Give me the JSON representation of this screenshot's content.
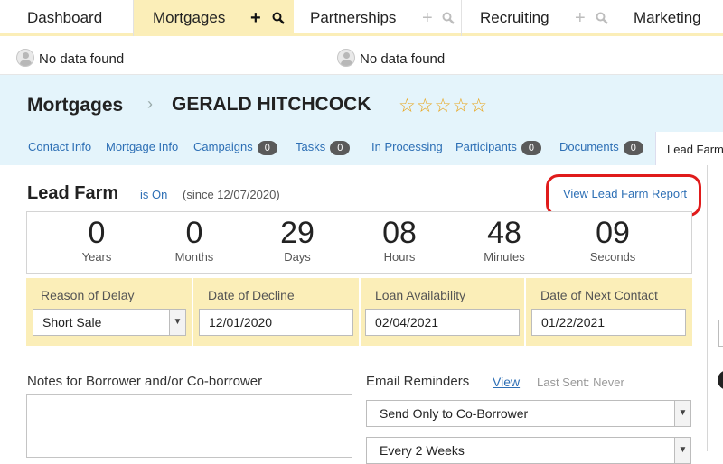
{
  "topnav": {
    "tabs": [
      {
        "label": "Dashboard"
      },
      {
        "label": "Mortgages"
      },
      {
        "label": "Partnerships"
      },
      {
        "label": "Recruiting"
      },
      {
        "label": "Marketing"
      }
    ],
    "add_glyph": "+",
    "search_glyph": "⚲"
  },
  "owners": [
    {
      "text": "No data found"
    },
    {
      "text": "No data found"
    }
  ],
  "header": {
    "module": "Mortgages",
    "separator": "›",
    "contact_name": "GERALD HITCHCOCK",
    "stars": "☆☆☆☆☆",
    "rating": 0,
    "star_color": "#e8a317"
  },
  "subtabs": {
    "contact_info": "Contact Info",
    "mortgage_info": "Mortgage Info",
    "campaigns": "Campaigns",
    "campaigns_count": "0",
    "tasks": "Tasks",
    "tasks_count": "0",
    "in_processing": "In Processing",
    "participants": "Participants",
    "participants_count": "0",
    "documents": "Documents",
    "documents_count": "0",
    "lead_farm": "Lead Farm"
  },
  "leadfarm": {
    "title": "Lead Farm",
    "status": "is On",
    "since": "(since 12/07/2020)",
    "report_link": "View Lead Farm Report",
    "highlight_color": "#e01b1b",
    "counters": [
      {
        "value": "0",
        "unit": "Years"
      },
      {
        "value": "0",
        "unit": "Months"
      },
      {
        "value": "29",
        "unit": "Days"
      },
      {
        "value": "08",
        "unit": "Hours"
      },
      {
        "value": "48",
        "unit": "Minutes"
      },
      {
        "value": "09",
        "unit": "Seconds"
      }
    ],
    "fields": {
      "reason_label": "Reason of Delay",
      "reason_value": "Short Sale",
      "decline_label": "Date of Decline",
      "decline_value": "12/01/2020",
      "loan_label": "Loan Availability",
      "loan_value": "02/04/2021",
      "next_label": "Date of Next Contact",
      "next_value": "01/22/2021"
    }
  },
  "lower": {
    "notes_label": "Notes for Borrower and/or Co-borrower",
    "email_label": "Email Reminders",
    "email_view": "View",
    "email_last": "Last Sent: Never",
    "send_to": "Send Only to Co-Borrower",
    "frequency": "Every 2 Weeks"
  },
  "colors": {
    "accent_yellow": "#fbeeb8",
    "header_blue": "#e4f4fb",
    "link_blue": "#2d6fb5"
  }
}
